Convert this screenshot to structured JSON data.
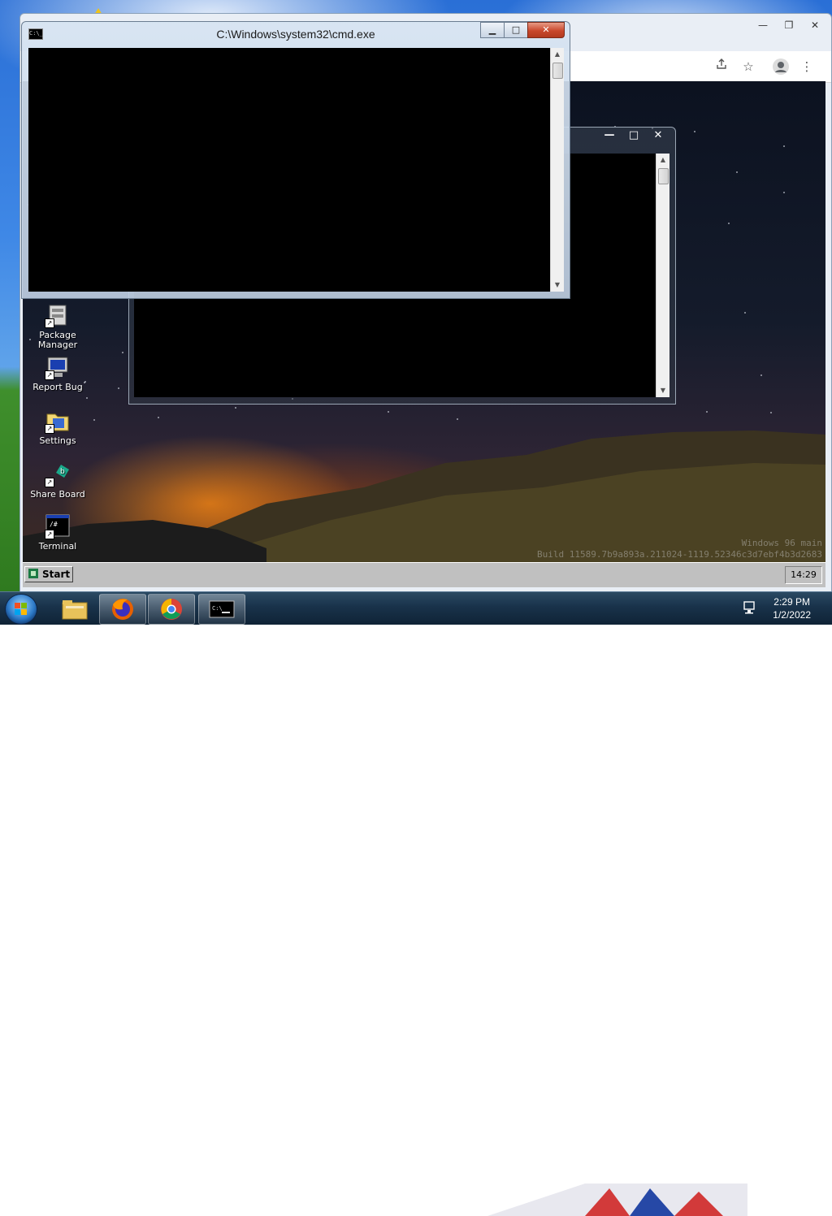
{
  "host": {
    "browser": {
      "toolbar": {
        "share_icon": "share-icon",
        "bookmark_icon": "star-icon",
        "profile_icon": "profile-icon",
        "menu_icon": "kebab-menu-icon"
      },
      "caption_buttons": [
        "minimize",
        "maximize",
        "close"
      ]
    },
    "taskbar": {
      "time": "2:29 PM",
      "date": "1/2/2022",
      "apps": [
        "file-explorer",
        "firefox",
        "chrome",
        "command-prompt"
      ]
    }
  },
  "w96": {
    "desktop_icons": [
      {
        "label": "Package Manager",
        "icon": "package-manager-icon"
      },
      {
        "label": "Report Bug",
        "icon": "report-bug-icon"
      },
      {
        "label": "Settings",
        "icon": "settings-icon"
      },
      {
        "label": "Share Board",
        "icon": "share-board-icon"
      },
      {
        "label": "Terminal",
        "icon": "terminal-icon"
      }
    ],
    "watermark": {
      "line1": "Windows 96 main",
      "line2": "Build 11589.7b9a893a.211024-1119.52346c3d7ebf4b3d2683"
    },
    "taskbar": {
      "start_label": "Start",
      "clock": "14:29"
    }
  },
  "cmd_front": {
    "title": "C:\\Windows\\system32\\cmd.exe",
    "icon_text": "C:\\_"
  },
  "cmd_back": {
    "caption": {
      "min": "—",
      "max": "□",
      "close": "✕"
    }
  },
  "colors": {
    "console_bg": "#000000",
    "w96_taskbar": "#c0c0c0",
    "win7_taskbar": "#19324a"
  }
}
